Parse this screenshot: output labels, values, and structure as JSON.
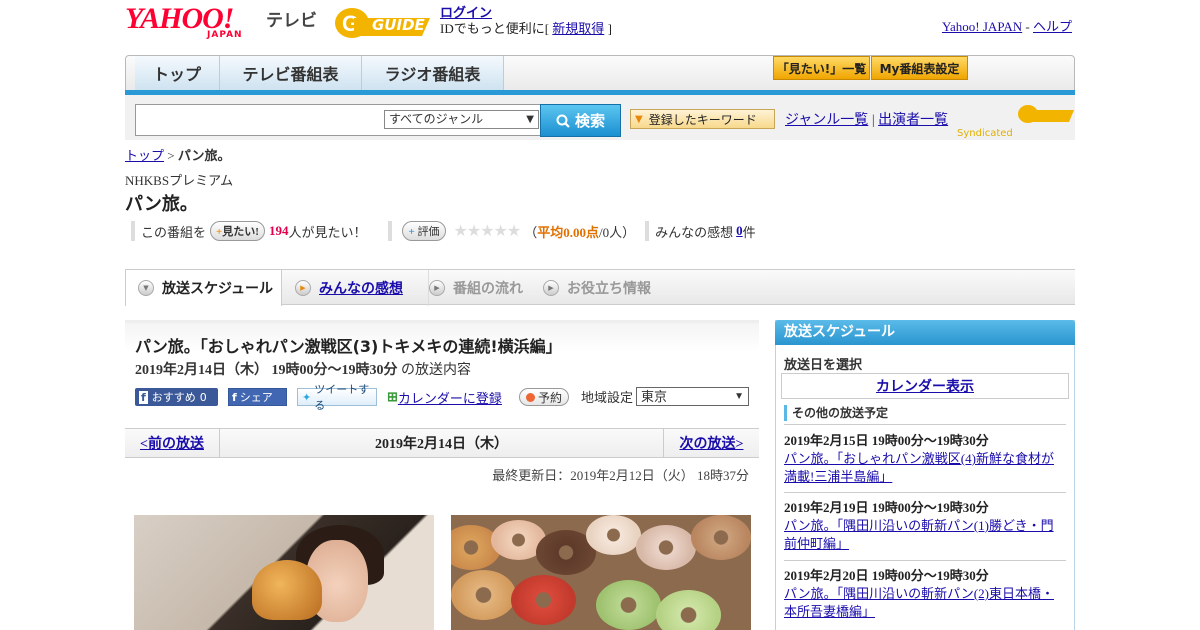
{
  "header": {
    "brand_yahoo": "YAHOO!",
    "brand_japan": "JAPAN",
    "brand_tv": "テレビ",
    "brand_gguide": "GUIDE",
    "login_link": "ログイン",
    "login_promo": "IDでもっと便利に[",
    "signup_link": "新規取得",
    "login_promo_end": "]",
    "yahoo_japan_link": "Yahoo! JAPAN",
    "dash": "-",
    "help_link": "ヘルプ"
  },
  "nav": {
    "tabs": [
      {
        "label": "トップ"
      },
      {
        "label": "テレビ番組表"
      },
      {
        "label": "ラジオ番組表"
      }
    ],
    "mitai_list": "「見たい!」一覧",
    "my_schedule": "My番組表設定"
  },
  "search": {
    "input_value": "",
    "genre_selected": "すべてのジャンル",
    "search_button": "検索",
    "keyword_button": "登録したキーワード",
    "genre_list_link": "ジャンル一覧",
    "link_sep": "|",
    "performer_list_link": "出演者一覧",
    "syndicated": "Syndicated"
  },
  "breadcrumb": {
    "top": "トップ",
    "sep": ">",
    "current": "パン旅。"
  },
  "program": {
    "channel": "NHKBSプレミアム",
    "title": "パン旅。",
    "want_prefix": "この番組を",
    "want_pill": "見たい!",
    "want_count": "194",
    "want_suffix": "人が見たい！",
    "rate_pill": "評価",
    "stars": "★★★★★",
    "rating_open": "（",
    "rating_avg": "平均0.00点",
    "rating_people": "/0人）",
    "review_prefix": "みんなの感想",
    "review_count": "0",
    "review_suffix": "件"
  },
  "content_tabs": [
    {
      "label": "放送スケジュール",
      "active": true
    },
    {
      "label": "みんなの感想",
      "active": false
    },
    {
      "label": "番組の流れ",
      "active": false
    },
    {
      "label": "お役立ち情報",
      "active": false
    }
  ],
  "episode": {
    "title": "パン旅。「おしゃれパン激戦区(3)トキメキの連続!横浜編」",
    "datetime": "2019年2月14日（木） 19時00分～19時30分",
    "datetime_suffix": "の放送内容",
    "fb_recommend": "おすすめ",
    "fb_recommend_count": "0",
    "fb_share": "シェア",
    "tweet": "ツイートする",
    "calendar_add": "カレンダーに登録",
    "reserve": "予約",
    "region_label": "地域設定",
    "region_selected": "東京"
  },
  "pager": {
    "prev": "<前の放送",
    "current": "2019年2月14日（木）",
    "next": "次の放送>"
  },
  "last_updated": "最終更新日：2019年2月12日（火） 18時37分",
  "sidebar": {
    "title": "放送スケジュール",
    "select_date": "放送日を選択",
    "calendar_button": "カレンダー表示",
    "other_heading": "その他の放送予定",
    "items": [
      {
        "datetime": "2019年2月15日 19時00分～19時30分",
        "title": "パン旅。「おしゃれパン激戦区(4)新鮮な食材が満載!三浦半島編」"
      },
      {
        "datetime": "2019年2月19日 19時00分～19時30分",
        "title": "パン旅。「隅田川沿いの斬新パン(1)勝どき・門前仲町編」"
      },
      {
        "datetime": "2019年2月20日 19時00分～19時30分",
        "title": "パン旅。「隅田川沿いの斬新パン(2)東日本橋・本所吾妻橋編」"
      }
    ]
  },
  "colors": {
    "yahoo_red": "#ff0033",
    "nav_blue": "#2a9ad6",
    "link": "#1a0dab",
    "accent_pink": "#e0004b"
  }
}
